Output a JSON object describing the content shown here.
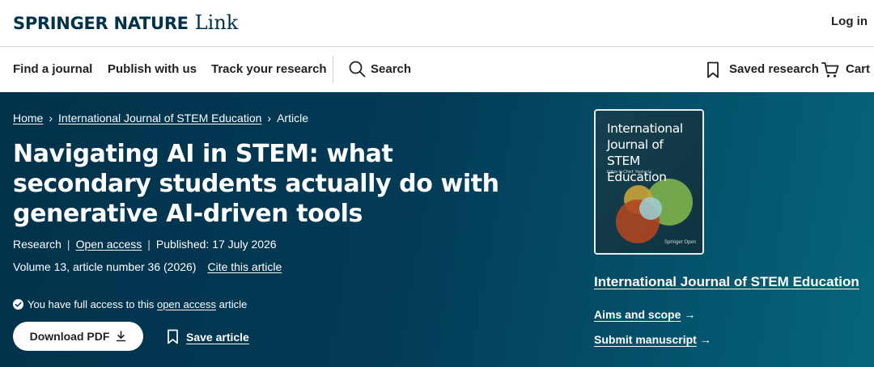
{
  "header": {
    "brand_main": "SPRINGER NATURE",
    "brand_link": "Link",
    "login": "Log in"
  },
  "nav": {
    "find_journal": "Find a journal",
    "publish": "Publish with us",
    "track": "Track your research",
    "search": "Search",
    "saved": "Saved research",
    "cart": "Cart"
  },
  "breadcrumb": {
    "home": "Home",
    "journal": "International Journal of STEM Education",
    "current": "Article"
  },
  "article": {
    "title": "Navigating AI in STEM: what secondary students actually do with generative AI-driven tools",
    "type": "Research",
    "access": "Open access",
    "published": "Published: 17 July 2026",
    "volume": "Volume 13, article number 36 (2026)",
    "cite": "Cite this article",
    "access_note_prefix": "You have full access to this",
    "access_note_link": "open access",
    "access_note_suffix": "article",
    "download": "Download PDF",
    "save": "Save article"
  },
  "journal": {
    "cover_title_line1": "International",
    "cover_title_line2": "Journal of",
    "cover_title_line3": "STEM Education",
    "cover_editor": "Editor-in-Chief: Yeping Li",
    "cover_brand": "Springer Open",
    "name": "International Journal of STEM Education",
    "aims": "Aims and scope",
    "submit": "Submit manuscript"
  },
  "colors": {
    "brand_navy": "#01324b",
    "hero_start": "#01324b",
    "hero_end": "#056679"
  }
}
